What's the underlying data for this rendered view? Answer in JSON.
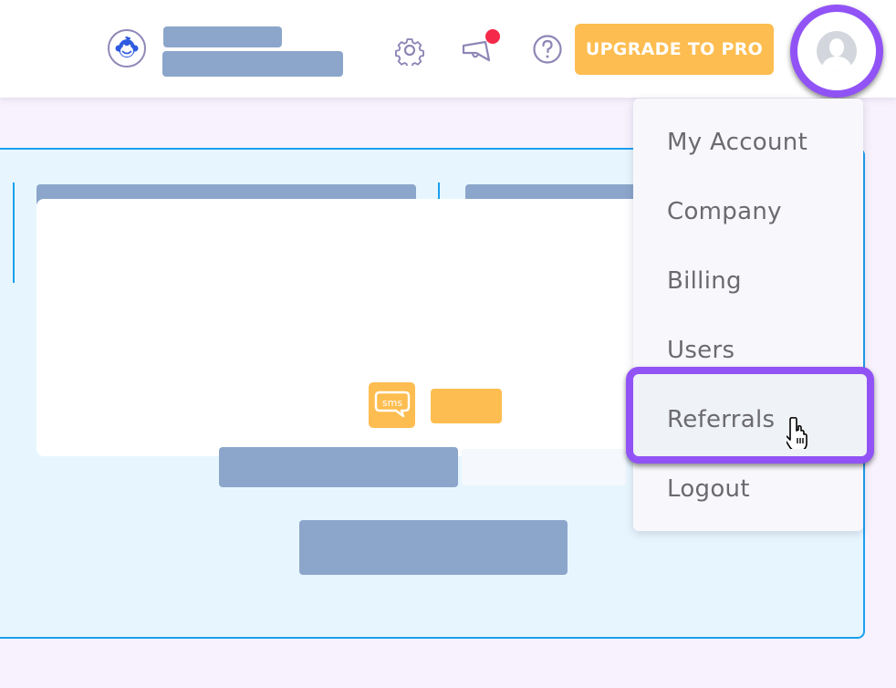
{
  "header": {
    "logo_icon": "monkey-logo-icon",
    "settings_icon": "gear-icon",
    "announcements_icon": "megaphone-icon",
    "announcements_badge_color": "#f5294a",
    "help_icon": "question-circle-icon",
    "upgrade_label": "UPGRADE TO PRO",
    "avatar_icon": "user-avatar-icon"
  },
  "colors": {
    "accent_purple": "#9153f5",
    "upgrade_yellow": "#fdbd50",
    "panel_border_blue": "#1aa0f0",
    "placeholder_blue": "#8ca6cb"
  },
  "content": {
    "sms_icon_label": "sms"
  },
  "account_menu": {
    "items": [
      {
        "label": "My Account"
      },
      {
        "label": "Company"
      },
      {
        "label": "Billing"
      },
      {
        "label": "Users"
      },
      {
        "label": "Referrals",
        "highlighted": true
      },
      {
        "label": "Logout"
      }
    ]
  }
}
